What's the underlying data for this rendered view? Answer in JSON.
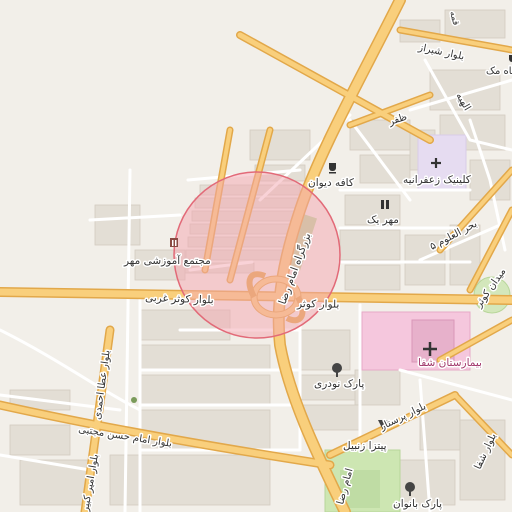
{
  "map": {
    "highlight": {
      "fill": "#f4a6b0",
      "stroke": "#e26a78",
      "opacity": 0.55
    },
    "colors": {
      "land": "#f2efe9",
      "block": "#e1dcd3",
      "block_stroke": "#cfc8bd",
      "road_major": "#f7c66b",
      "road_major_casing": "#e5aa45",
      "road_minor": "#ffffff",
      "hospital": "#f5c5dc",
      "park": "#cde6b2",
      "clinic_area": "#e2d8ef"
    },
    "labels": {
      "boulevard_kowsar_west": "بلوار کوثر غربی",
      "boulevard_kowsar": "بلوار کوثر",
      "imam_reza_highway": "بزرگراه امام رضا",
      "imam_reza_south": "امام رضا",
      "ata_ahmadi": "بلوار عطا احمدی",
      "imam_hassan_mojtaba": "بلوار امام حسن مجتبی",
      "amir_kabir": "بلوار امیر کبیر",
      "parastar": "بلوار پرستار",
      "shafa_blvd": "بلوار شفا",
      "shiraz": "بلوار شیراز",
      "zafar": "ظفر",
      "elahiyeh": "الهیه",
      "bahr_al_olum": "بحر العلوم ۵",
      "meydan_kowsar": "میدان کوثر",
      "complex_mehr": "مجتمع آموزشی مهر",
      "cafe_divan": "کافه دیوان",
      "mehr_yak": "مهر یک",
      "clinic_zafaranieh": "کلینیک زعفرانیه",
      "hospital_shafa": "بیمارستان شفا",
      "park_nowdari": "پارک نودری",
      "pizza_zanbil": "پیتزا زنبیل",
      "park_banovan": "پارک بانوان",
      "mah_mak": "ماه مک",
      "top_right_partial": "قمه"
    }
  }
}
